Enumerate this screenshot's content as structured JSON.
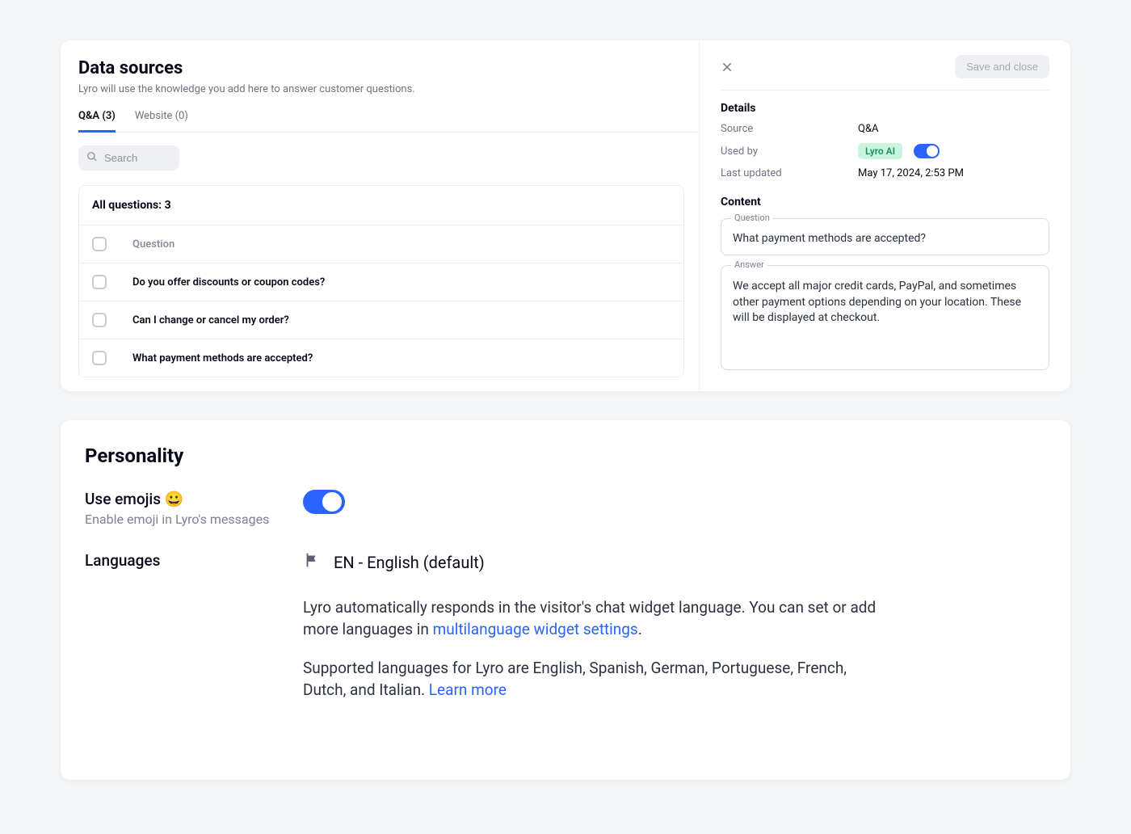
{
  "dataSources": {
    "title": "Data sources",
    "subtitle": "Lyro will use the knowledge you add here to answer customer questions.",
    "tabs": [
      {
        "label": "Q&A (3)",
        "active": true
      },
      {
        "label": "Website (0)",
        "active": false
      }
    ],
    "searchPlaceholder": "Search",
    "listHeader": "All questions: 3",
    "columnHeader": "Question",
    "questions": [
      "Do you offer discounts or coupon codes?",
      "Can I change or cancel my order?",
      "What payment methods are accepted?"
    ]
  },
  "panel": {
    "saveLabel": "Save and close",
    "detailsHeading": "Details",
    "sourceLabel": "Source",
    "sourceValue": "Q&A",
    "usedByLabel": "Used by",
    "usedByBadge": "Lyro AI",
    "lastUpdatedLabel": "Last updated",
    "lastUpdatedValue": "May 17, 2024, 2:53 PM",
    "contentHeading": "Content",
    "questionLegend": "Question",
    "questionValue": "What payment methods are accepted?",
    "answerLegend": "Answer",
    "answerValue": "We accept all major credit cards, PayPal, and sometimes other payment options depending on your location. These will be displayed at checkout."
  },
  "personality": {
    "title": "Personality",
    "emojiHeading": "Use emojis 😀",
    "emojiDesc": "Enable emoji in Lyro's messages",
    "langHeading": "Languages",
    "langValue": "EN - English (default)",
    "langPara1a": "Lyro automatically responds in the visitor's chat widget language. You can set or add more languages in ",
    "langLink1": "multilanguage widget settings",
    "langPara1b": ".",
    "langPara2a": "Supported languages for Lyro are English, Spanish, German, Portuguese, French, Dutch, and Italian. ",
    "langLink2": "Learn more"
  }
}
